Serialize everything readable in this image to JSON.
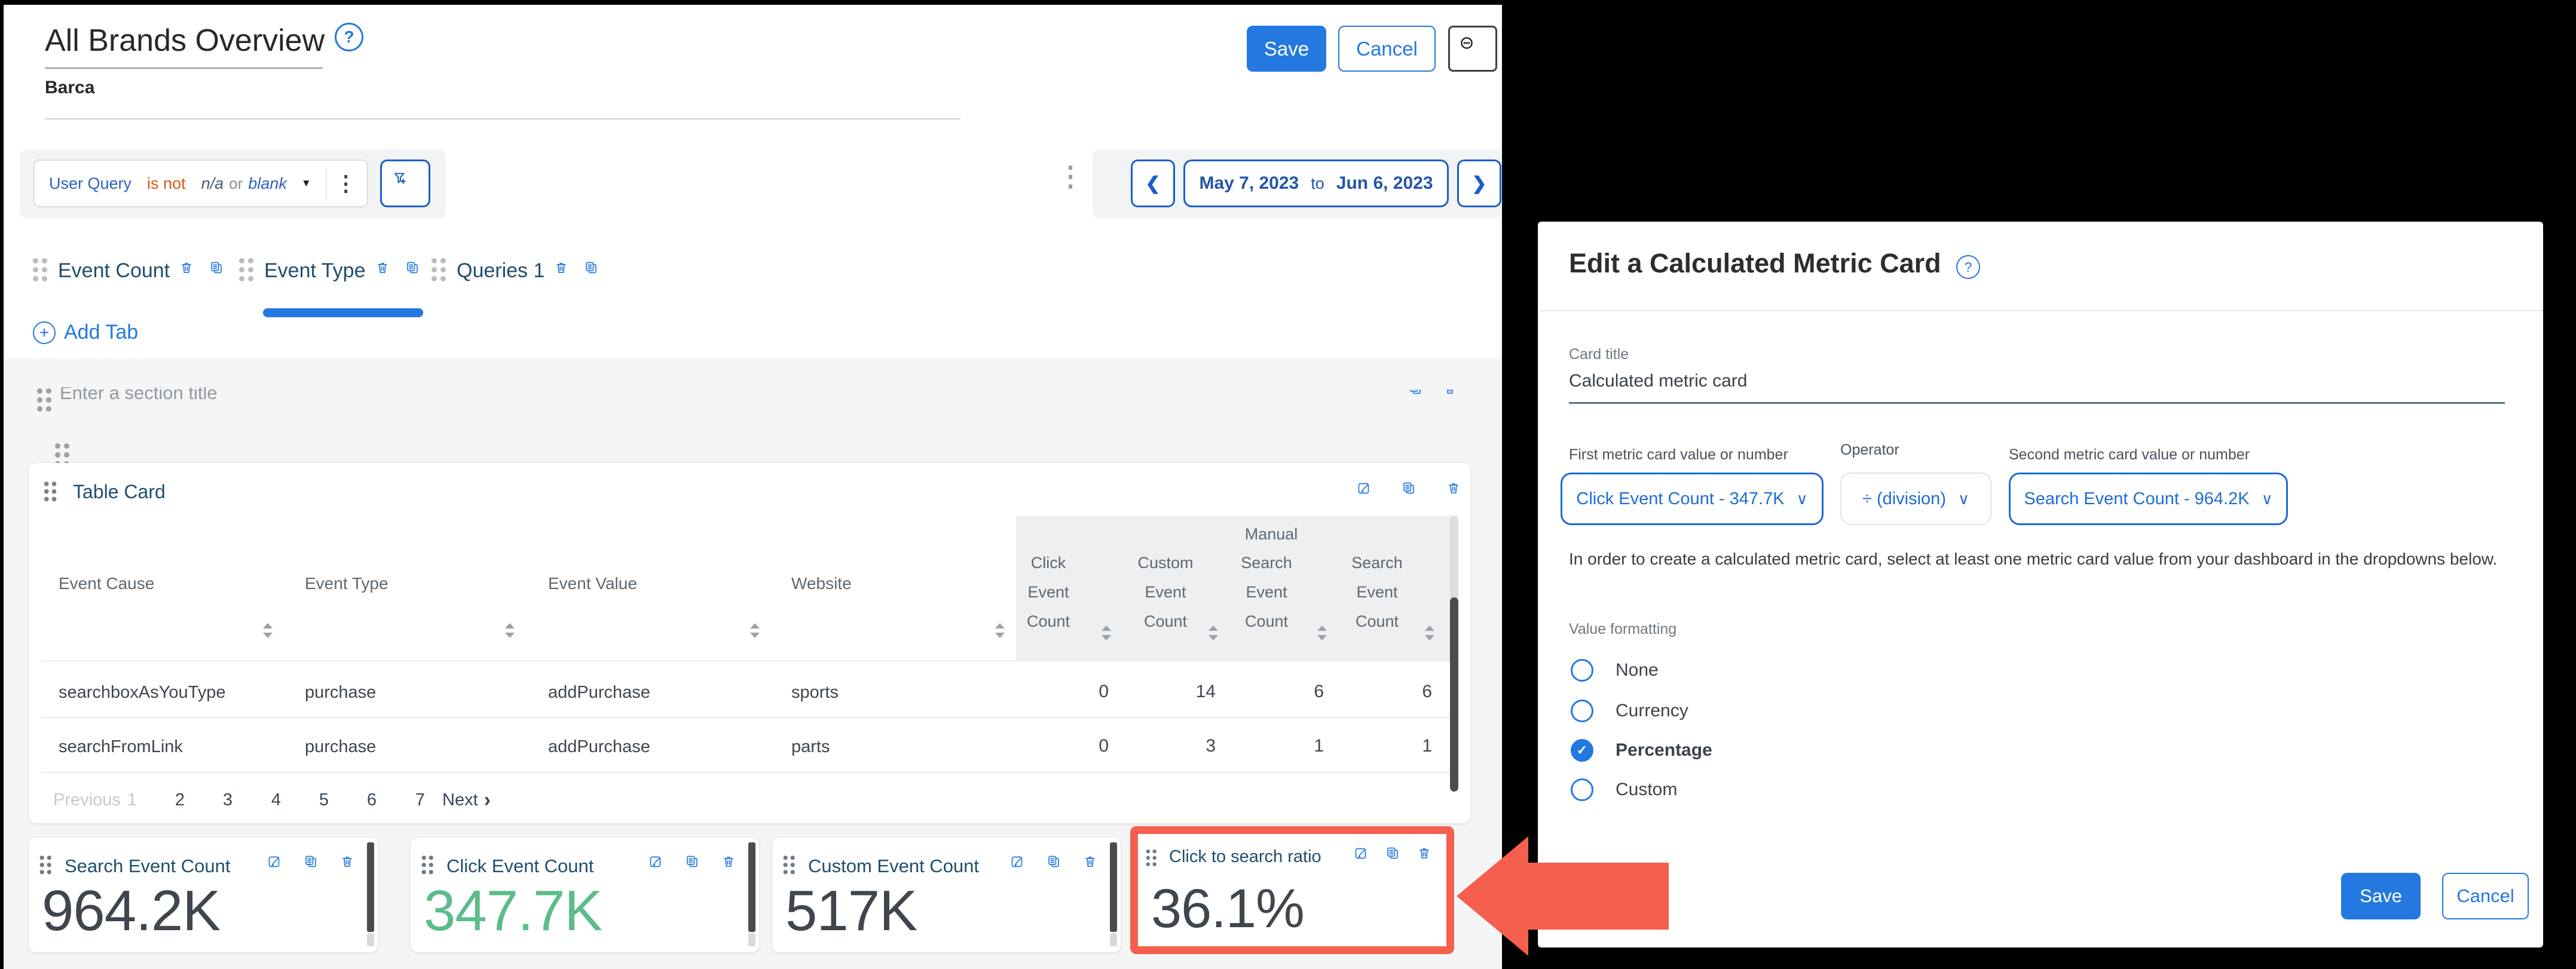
{
  "icons": {
    "help": "?",
    "kebab": "⋮",
    "caret_down": "▼",
    "chevron_left": "❮",
    "chevron_right": "❯",
    "select_chevron": "∨",
    "next_chevron": "›",
    "check": "✓",
    "plus": "+"
  },
  "dashboard": {
    "title": "All Brands Overview",
    "subtitle": "Barca",
    "save_label": "Save",
    "cancel_label": "Cancel",
    "filter": {
      "field": "User Query",
      "operator": "is not",
      "value": "n/a",
      "conjunction": "or",
      "value2": "blank"
    },
    "date_range": {
      "start": "May 7, 2023",
      "separator": "to",
      "end": "Jun 6, 2023"
    },
    "tabs": [
      {
        "label": "Event Count"
      },
      {
        "label": "Event Type"
      },
      {
        "label": "Queries 1"
      }
    ],
    "add_tab_label": "Add Tab",
    "section_title_placeholder": "Enter a section title",
    "table_card": {
      "title": "Table Card",
      "columns": [
        "Event Cause",
        "Event Type",
        "Event Value",
        "Website"
      ],
      "metric_group_label": "Manual",
      "metric_columns": [
        [
          "Click",
          "Event",
          "Count"
        ],
        [
          "Custom",
          "Event",
          "Count"
        ],
        [
          "Search",
          "Event",
          "Count"
        ],
        [
          "Search",
          "Event",
          "Count"
        ]
      ],
      "rows": [
        {
          "cells": [
            "searchboxAsYouType",
            "purchase",
            "addPurchase",
            "sports"
          ],
          "values": [
            "0",
            "14",
            "6",
            "6"
          ]
        },
        {
          "cells": [
            "searchFromLink",
            "purchase",
            "addPurchase",
            "parts"
          ],
          "values": [
            "0",
            "3",
            "1",
            "1"
          ]
        }
      ],
      "pagination": {
        "previous": "Previous",
        "pages": [
          "1",
          "2",
          "3",
          "4",
          "5",
          "6",
          "7"
        ],
        "next": "Next"
      }
    },
    "metric_cards": [
      {
        "title": "Search Event Count",
        "value": "964.2K"
      },
      {
        "title": "Click Event Count",
        "value": "347.7K"
      },
      {
        "title": "Custom Event Count",
        "value": "517K"
      },
      {
        "title": "Click to search ratio",
        "value": "36.1%"
      }
    ]
  },
  "modal": {
    "title": "Edit a Calculated Metric Card",
    "card_title_label": "Card title",
    "card_title_value": "Calculated metric card",
    "first_metric_label": "First metric card value or number",
    "operator_label": "Operator",
    "second_metric_label": "Second metric card value or number",
    "first_metric_value": "Click Event Count - 347.7K",
    "operator_value": "÷ (division)",
    "second_metric_value": "Search Event Count - 964.2K",
    "helper_text": "In order to create a calculated metric card, select at least one metric card value from your dashboard in the dropdowns below.",
    "value_formatting_label": "Value formatting",
    "format_options": [
      "None",
      "Currency",
      "Percentage",
      "Custom"
    ],
    "save_label": "Save",
    "cancel_label": "Cancel"
  },
  "colors": {
    "accent_blue": "#2379e0",
    "navy": "#1f4e6f",
    "green_value": "#5cbc8b",
    "highlight_red": "#f4604d",
    "operator_orange": "#d9531e"
  }
}
